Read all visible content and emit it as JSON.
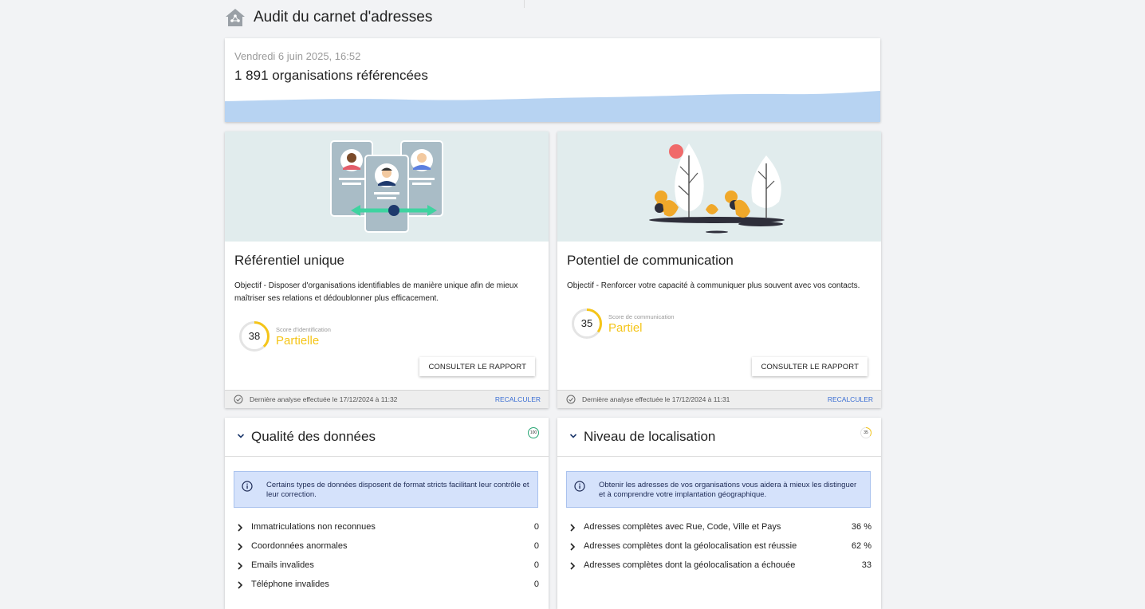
{
  "page": {
    "title": "Audit du carnet d'adresses",
    "logo_icon": "house-network-icon"
  },
  "summary": {
    "date": "Vendredi 6 juin 2025, 16:52",
    "count_text": "1 891 organisations référencées"
  },
  "cards": [
    {
      "title": "Référentiel unique",
      "description": "Objectif - Disposer d'organisations identifiables de manière unique afin de mieux maîtriser ses relations et dédoublonner plus efficacement.",
      "score_value": "38",
      "score_fraction": 0.38,
      "score_label": "Score d'identification",
      "score_status": "Partielle",
      "button_label": "CONSULTER LE RAPPORT",
      "footer_text": "Dernière analyse effectuée le 17/12/2024 à 11:32",
      "recalc_label": "RECALCULER",
      "illustration": "profile-cards-illustration"
    },
    {
      "title": "Potentiel de communication",
      "description": "Objectif - Renforcer votre capacité à communiquer plus souvent avec vos contacts.",
      "score_value": "35",
      "score_fraction": 0.35,
      "score_label": "Score de communication",
      "score_status": "Partiel",
      "button_label": "CONSULTER LE RAPPORT",
      "footer_text": "Dernière analyse effectuée le 17/12/2024 à 11:31",
      "recalc_label": "RECALCULER",
      "illustration": "trees-birds-illustration"
    }
  ],
  "sections": [
    {
      "title": "Qualité des données",
      "badge": "100",
      "badge_fraction": 1.0,
      "info": "Certains types de données disposent de format stricts facilitant leur contrôle et leur correction.",
      "rows": [
        {
          "label": "Immatriculations non reconnues",
          "value": "0"
        },
        {
          "label": "Coordonnées anormales",
          "value": "0"
        },
        {
          "label": "Emails invalides",
          "value": "0"
        },
        {
          "label": "Téléphone invalides",
          "value": "0"
        }
      ]
    },
    {
      "title": "Niveau de localisation",
      "badge": "35",
      "badge_fraction": 0.35,
      "info": "Obtenir les adresses de vos organisations vous aidera à mieux les distinguer et à comprendre votre implantation géographique.",
      "rows": [
        {
          "label": "Adresses complètes avec Rue, Code, Ville et Pays",
          "value": "36 %"
        },
        {
          "label": "Adresses complètes dont la géolocalisation est réussie",
          "value": "62 %"
        },
        {
          "label": "Adresses complètes dont la géolocalisation a échouée",
          "value": "33"
        }
      ]
    }
  ],
  "colors": {
    "accent_yellow": "#f5c518",
    "link_blue": "#3b6fd4",
    "info_bg": "#d5e2fb",
    "wave_blue": "#b7d3f2",
    "illustration_bg": "#e1eced"
  }
}
